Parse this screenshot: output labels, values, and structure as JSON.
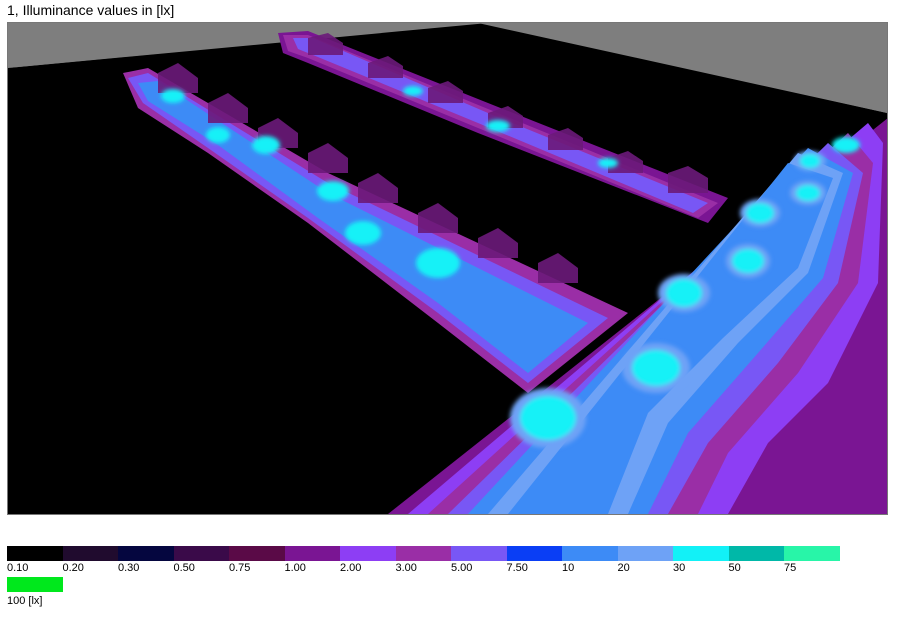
{
  "title": "1, Illuminance values in [lx]",
  "scale": {
    "entries": [
      {
        "label": "0.10",
        "color": "#000000"
      },
      {
        "label": "0.20",
        "color": "#200b2e"
      },
      {
        "label": "0.30",
        "color": "#05063f"
      },
      {
        "label": "0.50",
        "color": "#3a0a49"
      },
      {
        "label": "0.75",
        "color": "#5a0a47"
      },
      {
        "label": "1.00",
        "color": "#7a1593"
      },
      {
        "label": "2.00",
        "color": "#8d3ef4"
      },
      {
        "label": "3.00",
        "color": "#9a2ea6"
      },
      {
        "label": "5.00",
        "color": "#7857f5"
      },
      {
        "label": "7.50",
        "color": "#0a3ef5"
      },
      {
        "label": "10",
        "color": "#3d8bf6"
      },
      {
        "label": "20",
        "color": "#6ea2f6"
      },
      {
        "label": "30",
        "color": "#12f1f7"
      },
      {
        "label": "50",
        "color": "#00b8a8"
      },
      {
        "label": "75",
        "color": "#28f5a8"
      },
      {
        "label": "100 [lx]",
        "color": "#00e81c"
      }
    ]
  }
}
